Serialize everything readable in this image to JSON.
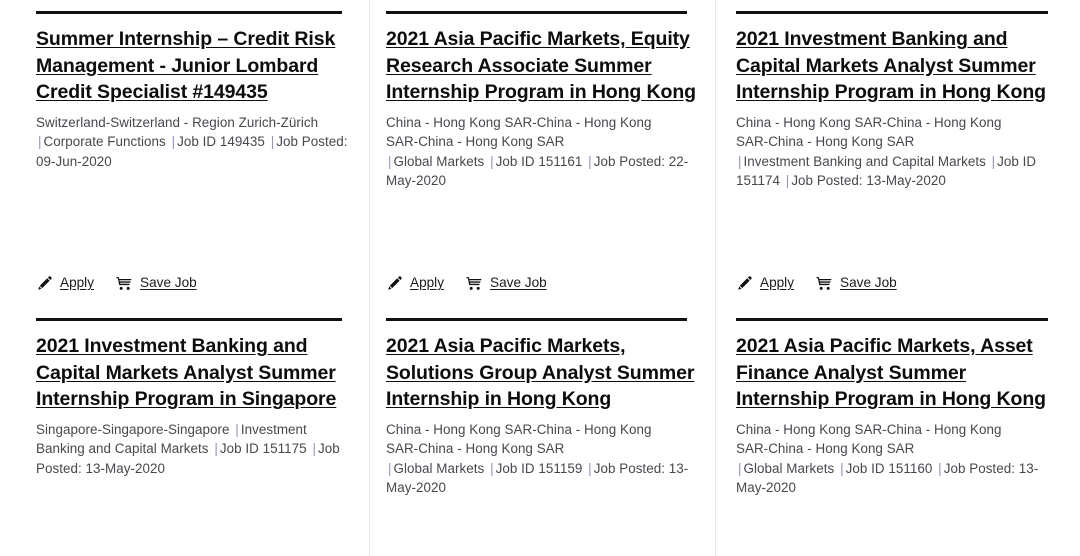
{
  "page": {
    "layout": "job-search-results-grid",
    "columns": 3,
    "rows": 2
  },
  "actions": {
    "apply_label": "Apply",
    "apply_icon": "pencil-icon",
    "save_label": "Save Job",
    "save_icon": "shopping-cart-icon"
  },
  "separator": "|",
  "colors": {
    "title": "#0d0d0d",
    "meta_text": "#47474e",
    "separator": "#9b8fb5",
    "rule": "#111111",
    "column_divider": "#e8e8ea",
    "background": "#ffffff"
  },
  "jobs": [
    {
      "title": "Summer Internship – Credit Risk Management - Junior Lombard Credit Specialist #149435",
      "location": "Switzerland-Switzerland - Region Zurich-Zürich",
      "location_line2": "",
      "department": "Corporate Functions",
      "job_id_label": "Job ID",
      "job_id": "149435",
      "posted_label": "Job Posted:",
      "posted_date": "09-Jun-2020",
      "has_actions": true
    },
    {
      "title": "2021 Asia Pacific Markets, Equity Research Associate Summer Internship Program in Hong Kong",
      "location": "China - Hong Kong SAR-China - Hong Kong",
      "location_line2": "SAR-China - Hong Kong SAR",
      "department": "Global Markets",
      "job_id_label": "Job ID",
      "job_id": "151161",
      "posted_label": "Job Posted:",
      "posted_date": "22-May-2020",
      "has_actions": true
    },
    {
      "title": "2021 Investment Banking and Capital Markets Analyst Summer Internship Program in Hong Kong",
      "location": "China - Hong Kong SAR-China - Hong Kong",
      "location_line2": "SAR-China - Hong Kong SAR",
      "department": "Investment Banking and Capital Markets",
      "job_id_label": "Job ID",
      "job_id": "151174",
      "posted_label": "Job Posted:",
      "posted_date": "13-May-2020",
      "has_actions": true
    },
    {
      "title": "2021 Investment Banking and Capital Markets Analyst Summer Internship Program in Singapore",
      "location": "Singapore-Singapore-Singapore",
      "location_line2": "",
      "department": "Investment Banking and Capital Markets",
      "job_id_label": "Job ID",
      "job_id": "151175",
      "posted_label": "Job Posted:",
      "posted_date": "13-May-2020",
      "has_actions": false
    },
    {
      "title": "2021 Asia Pacific Markets, Solutions Group Analyst Summer Internship in Hong Kong",
      "location": "China - Hong Kong SAR-China - Hong Kong",
      "location_line2": "SAR-China - Hong Kong SAR",
      "department": "Global Markets",
      "job_id_label": "Job ID",
      "job_id": "151159",
      "posted_label": "Job Posted:",
      "posted_date": "13-May-2020",
      "has_actions": false
    },
    {
      "title": "2021 Asia Pacific Markets, Asset Finance Analyst Summer Internship Program in Hong Kong",
      "location": "China - Hong Kong SAR-China - Hong Kong",
      "location_line2": "SAR-China - Hong Kong SAR",
      "department": "Global Markets",
      "job_id_label": "Job ID",
      "job_id": "151160",
      "posted_label": "Job Posted:",
      "posted_date": "13-May-2020",
      "has_actions": false
    }
  ]
}
